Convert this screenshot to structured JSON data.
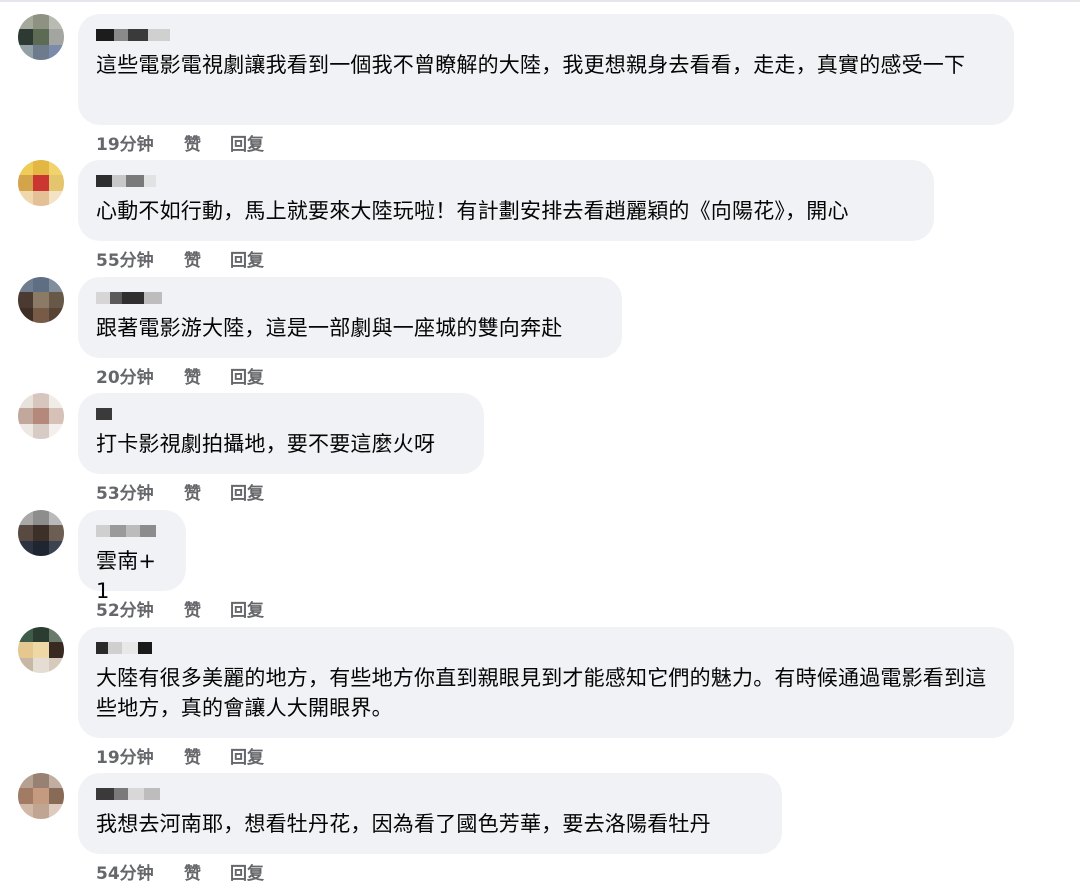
{
  "comments": [
    {
      "avatar_colors": [
        "#a4a99b",
        "#8d9280",
        "#b7bbb0",
        "#2c3a33",
        "#5c6a52",
        "#a3a6a0",
        "#93a0a8",
        "#6c7b8e",
        "#7a8ab0"
      ],
      "name_blocks": [
        "#1c1c1c",
        "#8a8a8a",
        "#3a3a3a",
        "#d0d0d0"
      ],
      "text": "這些電影電視劇讓我看到一個我不曾瞭解的大陸，我更想親身去看看，走走，真實的感受一下",
      "time": "19分钟",
      "like": "赞",
      "reply": "回复"
    },
    {
      "avatar_colors": [
        "#f2cc4a",
        "#e8b736",
        "#f3d35e",
        "#d9a440",
        "#d8322e",
        "#e7c463",
        "#f1d8a8",
        "#e7bf91",
        "#f6e2c0"
      ],
      "name_blocks": [
        "#2e2e2e",
        "#c8c8c8",
        "#7a7a7a",
        "#e2e2e2"
      ],
      "text": "心動不如行動，馬上就要來大陸玩啦！有計劃安排去看趙麗穎的《向陽花》，開心",
      "time": "55分钟",
      "like": "赞",
      "reply": "回复"
    },
    {
      "avatar_colors": [
        "#6e7d92",
        "#5d6f85",
        "#7f8ea0",
        "#4b3a30",
        "#8c7a64",
        "#6a5846",
        "#3f2e24",
        "#7a5b43",
        "#5b4332"
      ],
      "name_blocks": [
        "#d6d6d6",
        "#5a5a5a",
        "#2f2f2f",
        "#bdbdbd"
      ],
      "text": "跟著電影游大陸，這是一部劇與一座城的雙向奔赴",
      "time": "20分钟",
      "like": "赞",
      "reply": "回复"
    },
    {
      "avatar_colors": [
        "#e9e2dc",
        "#d9c6bc",
        "#f1ece8",
        "#c4a79a",
        "#b9877a",
        "#d8c1b6",
        "#eee8e4",
        "#d7cbc4",
        "#f3efec"
      ],
      "name_blocks": [
        "#3a3a3a"
      ],
      "text": "打卡影視劇拍攝地，要不要這麼火呀",
      "time": "53分钟",
      "like": "赞",
      "reply": "回复"
    },
    {
      "avatar_colors": [
        "#a8a8a8",
        "#8d8d8d",
        "#b9b9b9",
        "#5a4a40",
        "#3d3028",
        "#6e5e52",
        "#2c3440",
        "#1e2632",
        "#3a4452"
      ],
      "name_blocks": [
        "#cfcfcf",
        "#9a9a9a",
        "#bcbcbc",
        "#8c8c8c"
      ],
      "text": "雲南+1",
      "time": "52分钟",
      "like": "赞",
      "reply": "回复"
    },
    {
      "avatar_colors": [
        "#3d5d4a",
        "#2a3d30",
        "#6a7b6a",
        "#e8c88a",
        "#f0d9a0",
        "#3a2a20",
        "#c8b8a4",
        "#e6ddd2",
        "#d7cabb"
      ],
      "name_blocks": [
        "#2a2a2a",
        "#cfcfcf",
        "#e8e8e8",
        "#1a1a1a"
      ],
      "text": "大陸有很多美麗的地方，有些地方你直到親眼見到才能感知它們的魅力。有時候通過電影看到這些地方，真的會讓人大開眼界。",
      "time": "19分钟",
      "like": "赞",
      "reply": "回复"
    },
    {
      "avatar_colors": [
        "#b8a090",
        "#9a8070",
        "#c4ae9e",
        "#a47a60",
        "#c89a7a",
        "#8a6a54",
        "#d4b8a4",
        "#c2a590",
        "#e0cbbb"
      ],
      "name_blocks": [
        "#3a3a3a",
        "#7a7a7a",
        "#d8d8d8",
        "#bdbdbd"
      ],
      "text": "我想去河南耶，想看牡丹花，因為看了國色芳華，要去洛陽看牡丹",
      "time": "54分钟",
      "like": "赞",
      "reply": "回复"
    }
  ]
}
